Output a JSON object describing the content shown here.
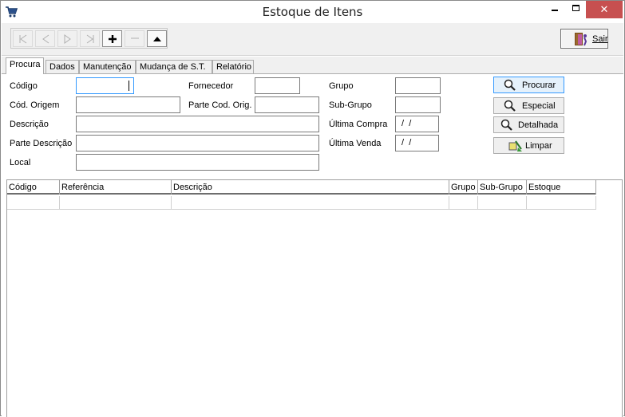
{
  "window": {
    "title": "Estoque de Itens",
    "app_icon": "cart-icon",
    "controls": {
      "minimize": "minimize-icon",
      "maximize": "maximize-icon",
      "close": "close-icon",
      "close_glyph": "✕",
      "close_color": "#c75050"
    }
  },
  "toolbar": {
    "nav_buttons": [
      {
        "name": "first-record-button",
        "icon": "first-icon"
      },
      {
        "name": "prev-record-button",
        "icon": "prev-icon"
      },
      {
        "name": "next-record-button",
        "icon": "next-icon"
      },
      {
        "name": "last-record-button",
        "icon": "last-icon"
      },
      {
        "name": "add-record-button",
        "icon": "plus-icon"
      },
      {
        "name": "delete-record-button",
        "icon": "minus-icon"
      },
      {
        "name": "edit-record-button",
        "icon": "triangle-up-icon"
      }
    ],
    "exit_label": "Sair"
  },
  "tabs": [
    {
      "label": "Procura",
      "active": true
    },
    {
      "label": "Dados",
      "active": false
    },
    {
      "label": "Manutenção",
      "active": false
    },
    {
      "label": "Mudança de S.T.",
      "active": false
    },
    {
      "label": "Relatório",
      "active": false
    }
  ],
  "form": {
    "codigo_label": "Código",
    "cod_origem_label": "Cód. Origem",
    "descricao_label": "Descrição",
    "parte_descricao_label": "Parte Descrição",
    "local_label": "Local",
    "fornecedor_label": "Fornecedor",
    "parte_cod_orig_label": "Parte Cod. Orig.",
    "grupo_label": "Grupo",
    "sub_grupo_label": "Sub-Grupo",
    "ultima_compra_label": "Última Compra",
    "ultima_venda_label": "Última Venda",
    "codigo_value": "",
    "cod_origem_value": "",
    "descricao_value": "",
    "parte_descricao_value": "",
    "local_value": "",
    "fornecedor_value": "",
    "parte_cod_orig_value": "",
    "grupo_value": "",
    "sub_grupo_value": "",
    "ultima_compra_value": " /  /",
    "ultima_venda_value": " /  /"
  },
  "actions": {
    "procurar_label": "Procurar",
    "especial_label": "Especial",
    "detalhada_label": "Detalhada",
    "limpar_label": "Limpar"
  },
  "grid": {
    "columns": [
      "Código",
      "Referência",
      "Descrição",
      "Grupo",
      "Sub-Grupo",
      "Estoque"
    ],
    "rows": []
  },
  "colors": {
    "accent_focus": "#3399ff",
    "close_button": "#c75050",
    "chrome_bg": "#f0f0f0"
  }
}
